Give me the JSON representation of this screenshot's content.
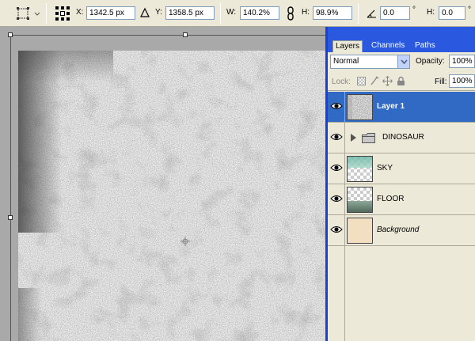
{
  "options_bar": {
    "x_label": "X:",
    "x_value": "1342.5 px",
    "y_label": "Y:",
    "y_value": "1358.5 px",
    "w_label": "W:",
    "w_value": "140.2%",
    "h_label": "H:",
    "h_value": "98.9%",
    "angle_value": "0.0",
    "angle_unit": "°",
    "hskew_label": "H:",
    "hskew_value": "0.0",
    "hskew_unit": "°"
  },
  "layers_panel": {
    "tabs": [
      {
        "label": "Layers",
        "active": true
      },
      {
        "label": "Channels",
        "active": false
      },
      {
        "label": "Paths",
        "active": false
      }
    ],
    "blend_mode": "Normal",
    "opacity_label": "Opacity:",
    "opacity_value": "100%",
    "lock_label": "Lock:",
    "fill_label": "Fill:",
    "fill_value": "100%",
    "layers": [
      {
        "name": "Layer 1",
        "selected": true,
        "visible": true,
        "thumb": "texture"
      },
      {
        "name": "DINOSAUR",
        "selected": false,
        "visible": true,
        "thumb": "folder"
      },
      {
        "name": "SKY",
        "selected": false,
        "visible": true,
        "thumb": "sky"
      },
      {
        "name": "FLOOR",
        "selected": false,
        "visible": true,
        "thumb": "floor"
      },
      {
        "name": "Background",
        "selected": false,
        "visible": true,
        "thumb": "beige"
      }
    ]
  },
  "colors": {
    "selection": "#316ac5",
    "panel_title": "#2a59e0",
    "panel_bg": "#ece9d8",
    "background_layer": "#f2dfc2"
  }
}
